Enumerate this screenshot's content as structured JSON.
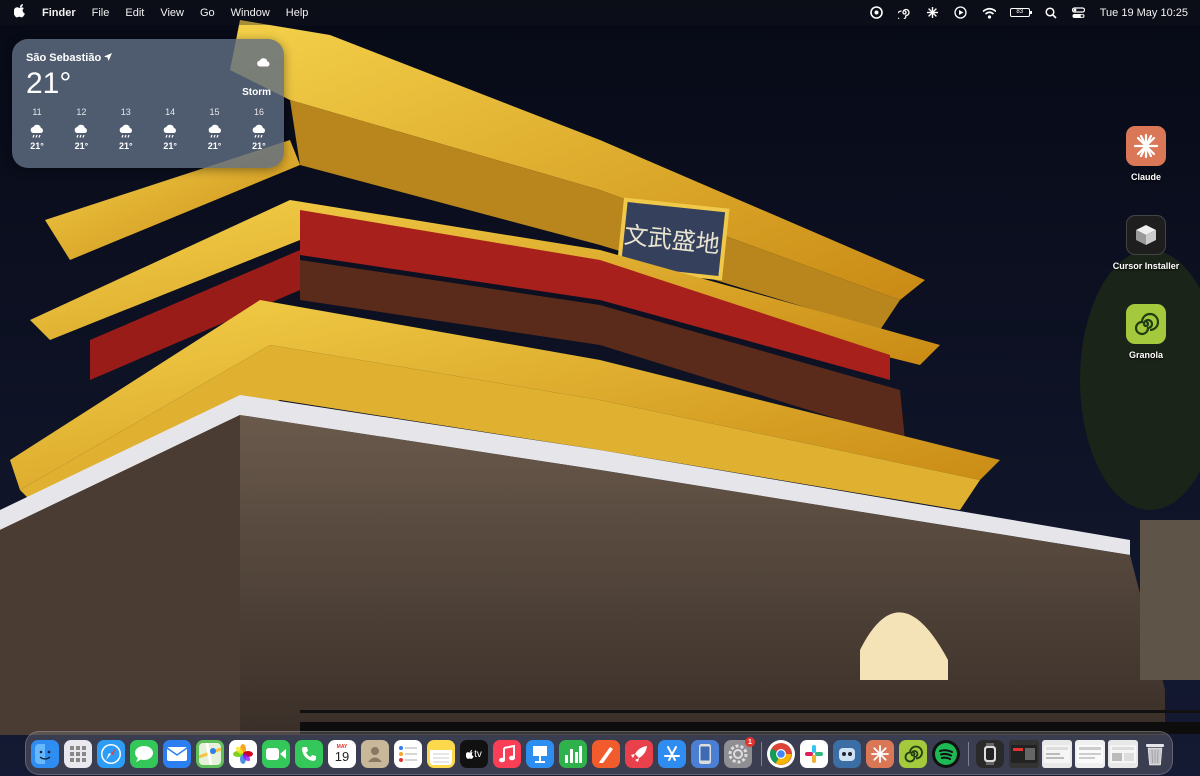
{
  "menubar": {
    "app_name": "Finder",
    "menus": [
      "File",
      "Edit",
      "View",
      "Go",
      "Window",
      "Help"
    ],
    "battery_label": "83",
    "clock": "Tue 19 May  10:25"
  },
  "weather": {
    "location": "São Sebastião",
    "temperature": "21°",
    "condition": "Storm",
    "forecast": [
      {
        "day": "11",
        "temp": "21°"
      },
      {
        "day": "12",
        "temp": "21°"
      },
      {
        "day": "13",
        "temp": "21°"
      },
      {
        "day": "14",
        "temp": "21°"
      },
      {
        "day": "15",
        "temp": "21°"
      },
      {
        "day": "16",
        "temp": "21°"
      }
    ]
  },
  "wallpaper": {
    "sign_text": "文武盛地"
  },
  "desktop_icons": [
    {
      "label": "Claude",
      "color": "#d97757",
      "icon": "claude-icon"
    },
    {
      "label": "Cursor Installer",
      "color": "#1e1e1e",
      "icon": "cursor-cube-icon"
    },
    {
      "label": "Granola",
      "color": "#a4c93c",
      "icon": "granola-spiral-icon"
    }
  ],
  "dock": {
    "calendar_day": "19",
    "calendar_month": "MAY",
    "tv_label": "tv",
    "settings_badge": "1",
    "apps": [
      {
        "name": "Finder",
        "icon": "finder-icon",
        "color": "#2f8cf0"
      },
      {
        "name": "Launchpad",
        "icon": "launchpad-icon",
        "color": "#e8e8ee"
      },
      {
        "name": "Safari",
        "icon": "safari-icon",
        "color": "#2d9cf4"
      },
      {
        "name": "Messages",
        "icon": "messages-icon",
        "color": "#34c759"
      },
      {
        "name": "Mail",
        "icon": "mail-icon",
        "color": "#2b7ff0"
      },
      {
        "name": "Maps",
        "icon": "maps-icon",
        "color": "#5fbf5a"
      },
      {
        "name": "Photos",
        "icon": "photos-icon",
        "color": "#ffffff"
      },
      {
        "name": "FaceTime",
        "icon": "facetime-icon",
        "color": "#34c759"
      },
      {
        "name": "Phone",
        "icon": "phone-icon",
        "color": "#34c759"
      },
      {
        "name": "Calendar",
        "icon": "calendar-icon",
        "color": "#ffffff"
      },
      {
        "name": "Contacts",
        "icon": "contacts-icon",
        "color": "#c9b79a"
      },
      {
        "name": "Reminders",
        "icon": "reminders-icon",
        "color": "#ffffff"
      },
      {
        "name": "Notes",
        "icon": "notes-icon",
        "color": "#fcd94c"
      },
      {
        "name": "TV",
        "icon": "tv-icon",
        "color": "#111111"
      },
      {
        "name": "Music",
        "icon": "music-icon",
        "color": "#fa3e55"
      },
      {
        "name": "Keynote",
        "icon": "keynote-icon",
        "color": "#2c8ef0"
      },
      {
        "name": "Numbers",
        "icon": "numbers-icon",
        "color": "#2fb24c"
      },
      {
        "name": "Pages",
        "icon": "pages-icon",
        "color": "#f25b2b"
      },
      {
        "name": "Rocket",
        "icon": "rocket-icon",
        "color": "#e8414b"
      },
      {
        "name": "App Store",
        "icon": "app-store-icon",
        "color": "#2f8cf0"
      },
      {
        "name": "Simulator",
        "icon": "simulator-icon",
        "color": "#4a7fd4"
      },
      {
        "name": "System Settings",
        "icon": "settings-gear-icon",
        "color": "#8e8e93"
      },
      {
        "name": "Chrome",
        "icon": "chrome-icon",
        "color": "#ffffff"
      },
      {
        "name": "Slack",
        "icon": "slack-icon",
        "color": "#ffffff"
      },
      {
        "name": "Finder Alt",
        "icon": "robot-face-icon",
        "color": "#3a6ea5"
      },
      {
        "name": "Claude",
        "icon": "claude-icon",
        "color": "#d97757"
      },
      {
        "name": "Granola",
        "icon": "granola-spiral-icon",
        "color": "#a4c93c"
      },
      {
        "name": "Spotify",
        "icon": "spotify-icon",
        "color": "#1db954"
      },
      {
        "name": "Watch",
        "icon": "watch-icon",
        "color": "#2a2a2a"
      },
      {
        "name": "Window Thumbnail 1",
        "icon": "window-thumbnail-icon",
        "color": "#333333"
      },
      {
        "name": "Window Thumbnail 2",
        "icon": "window-thumbnail-icon",
        "color": "#e8e8e8"
      },
      {
        "name": "Window Thumbnail 3",
        "icon": "window-thumbnail-icon",
        "color": "#f0f0f0"
      },
      {
        "name": "Window Thumbnail 4",
        "icon": "window-thumbnail-icon",
        "color": "#e8e8e8"
      },
      {
        "name": "Trash",
        "icon": "trash-icon",
        "color": "#c8c8cc"
      }
    ]
  }
}
